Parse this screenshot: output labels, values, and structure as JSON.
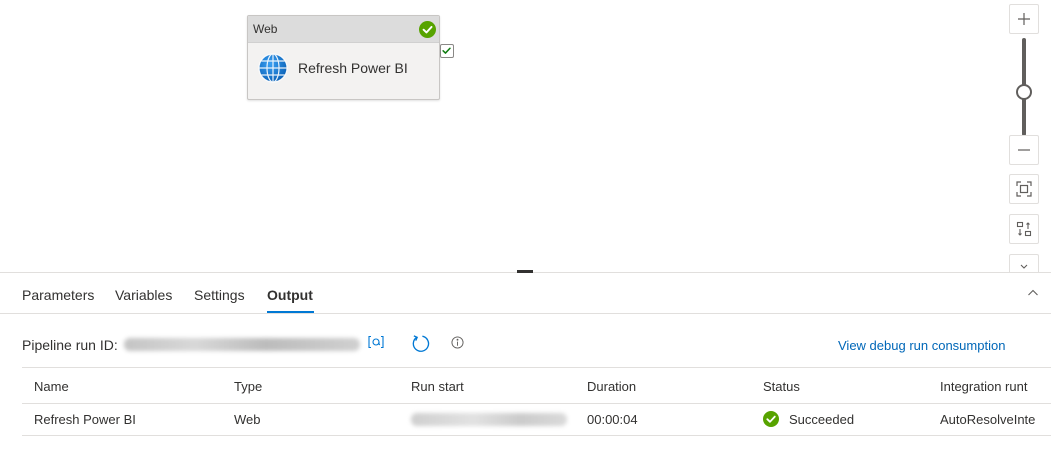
{
  "canvas": {
    "activity": {
      "type_label": "Web",
      "name": "Refresh Power BI",
      "icon": "globe-icon",
      "status_icon": "check-circle-icon"
    },
    "zoom_toolbar": {
      "zoom_in_icon": "plus-icon",
      "zoom_out_icon": "minus-icon",
      "fit_icon": "fit-to-screen-icon",
      "auto_align_icon": "auto-align-icon"
    }
  },
  "panel": {
    "tabs": [
      {
        "label": "Parameters"
      },
      {
        "label": "Variables"
      },
      {
        "label": "Settings"
      },
      {
        "label": "Output"
      }
    ],
    "active_tab": "Output",
    "run_id_label": "Pipeline run ID:",
    "debug_link": "View debug run consumption",
    "table": {
      "headers": [
        "Name",
        "Type",
        "Run start",
        "Duration",
        "Status",
        "Integration runt"
      ],
      "rows": [
        {
          "name": "Refresh Power BI",
          "type": "Web",
          "duration": "00:00:04",
          "status": "Succeeded",
          "integration_runtime": "AutoResolveInte"
        }
      ]
    }
  },
  "colors": {
    "accent": "#0078d4",
    "success": "#57a300",
    "link": "#0067b8"
  }
}
